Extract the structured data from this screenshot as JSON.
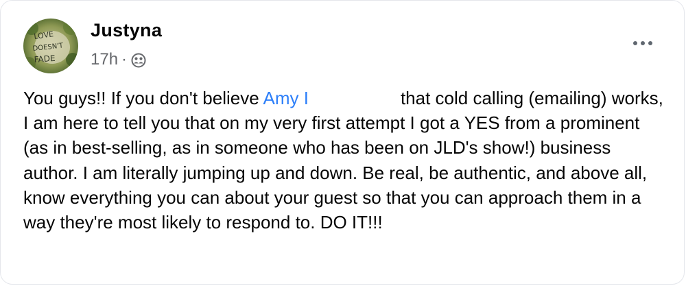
{
  "post": {
    "author": "Justyna",
    "time": "17h",
    "separator": "·",
    "audience_icon": "friends-icon",
    "more_icon": "more-options-icon",
    "avatar_text": [
      "LOVE",
      "DOESN'T",
      "FADE"
    ],
    "text_before_mention": "You guys!! If you don't believe ",
    "mention": "Amy",
    "mention_tail": "I",
    "text_after_mention": "that cold calling (emailing) works, I am here to tell you that on my very first attempt I got a YES from a prominent (as in best-selling, as in someone who has been on JLD's show!) business author. I am literally jumping up and down. Be real, be authentic, and above all, know everything you can about your guest so that you can approach them in a way they're most likely to respond to. DO IT!!!",
    "colors": {
      "link": "#2d7ff9",
      "secondary_text": "#65676b",
      "primary_text": "#050505"
    }
  }
}
